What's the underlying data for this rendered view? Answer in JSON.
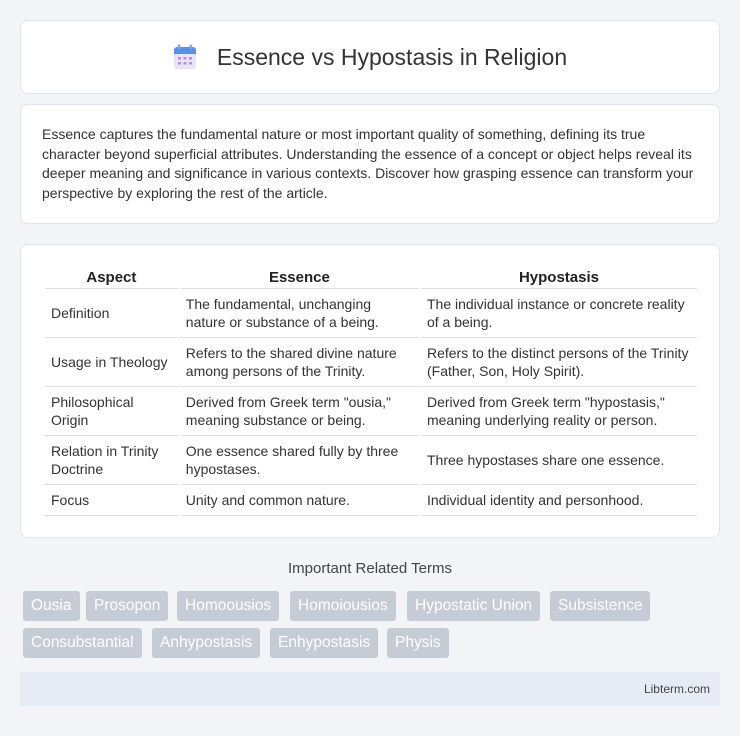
{
  "header": {
    "title": "Essence vs Hypostasis in Religion",
    "icon": "calendar-icon"
  },
  "intro": {
    "text": "Essence captures the fundamental nature or most important quality of something, defining its true character beyond superficial attributes. Understanding the essence of a concept or object helps reveal its deeper meaning and significance in various contexts. Discover how grasping essence can transform your perspective by exploring the rest of the article."
  },
  "table": {
    "headers": [
      "Aspect",
      "Essence",
      "Hypostasis"
    ],
    "rows": [
      [
        "Definition",
        "The fundamental, unchanging nature or substance of a being.",
        "The individual instance or concrete reality of a being."
      ],
      [
        "Usage in Theology",
        "Refers to the shared divine nature among persons of the Trinity.",
        "Refers to the distinct persons of the Trinity (Father, Son, Holy Spirit)."
      ],
      [
        "Philosophical Origin",
        "Derived from Greek term \"ousia,\" meaning substance or being.",
        "Derived from Greek term \"hypostasis,\" meaning underlying reality or person."
      ],
      [
        "Relation in Trinity Doctrine",
        "One essence shared fully by three hypostases.",
        "Three hypostases share one essence."
      ],
      [
        "Focus",
        "Unity and common nature.",
        "Individual identity and personhood."
      ]
    ]
  },
  "related": {
    "title": "Important Related Terms",
    "tags": [
      "Ousia",
      "Prosopon",
      "Homoousios",
      "Homoiousios",
      "Hypostatic Union",
      "Subsistence",
      "Consubstantial",
      "Anhypostasis",
      "Enhypostasis",
      "Physis"
    ]
  },
  "footer": {
    "site": "Libterm.com"
  },
  "colors": {
    "tag_bg": "#c5ccd6",
    "footer_bg": "#e6ecf6",
    "icon_blue": "#5b8def",
    "icon_purple": "#b58ce0"
  }
}
